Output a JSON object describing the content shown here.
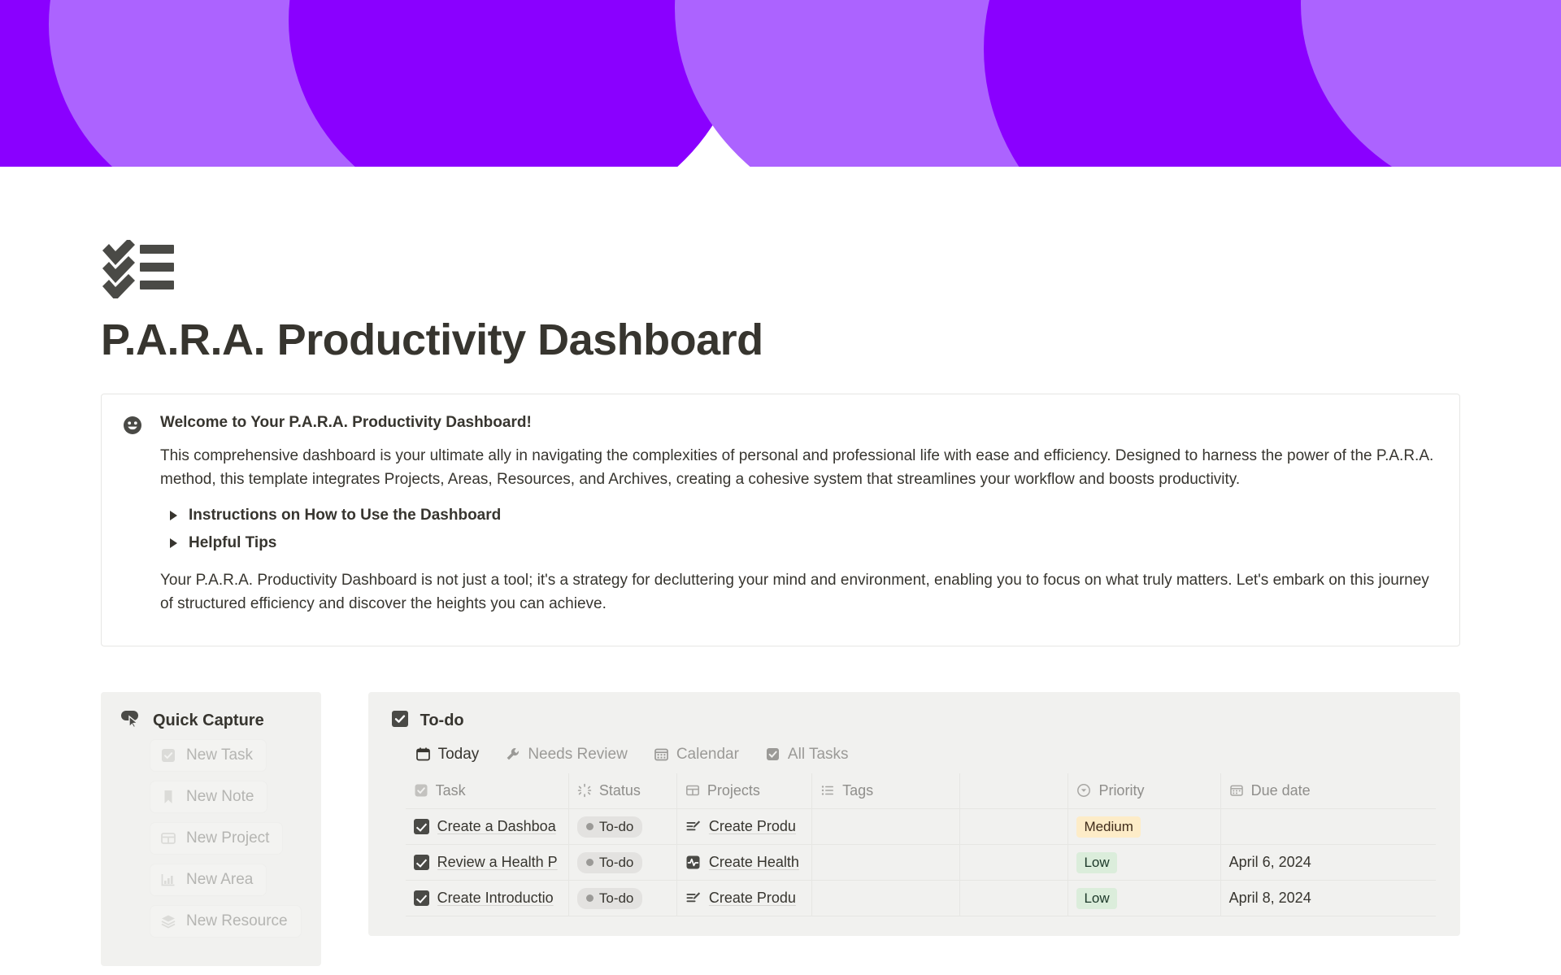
{
  "cover": {
    "colors": {
      "dark_purple": "#8A00FF",
      "light_purple": "#AC63FF"
    }
  },
  "page": {
    "icon": "checklist-icon",
    "title": "P.A.R.A. Productivity Dashboard"
  },
  "callout": {
    "emoji": "smiley-face-icon",
    "title": "Welcome to Your P.A.R.A. Productivity Dashboard!",
    "paragraph_1": "This comprehensive dashboard is your ultimate ally in navigating the complexities of personal and professional life with ease and efficiency. Designed to harness the power of the P.A.R.A. method, this template integrates Projects, Areas, Resources, and Archives, creating a cohesive system that streamlines your workflow and boosts productivity.",
    "toggles": [
      {
        "label": "Instructions on How to Use the Dashboard"
      },
      {
        "label": "Helpful Tips"
      }
    ],
    "paragraph_2": "Your P.A.R.A. Productivity Dashboard is not just a tool; it's a strategy for decluttering your mind and environment, enabling you to focus on what truly matters. Let's embark on this journey of structured efficiency and discover the heights you can achieve."
  },
  "quick_capture": {
    "icon": "cursor-click-icon",
    "title": "Quick Capture",
    "buttons": [
      {
        "label": "New Task",
        "icon": "checkbox-icon"
      },
      {
        "label": "New Note",
        "icon": "bookmark-icon"
      },
      {
        "label": "New Project",
        "icon": "table-icon"
      },
      {
        "label": "New Area",
        "icon": "bar-chart-icon"
      },
      {
        "label": "New Resource",
        "icon": "layers-icon"
      }
    ]
  },
  "todo": {
    "icon": "checkbox-icon",
    "title": "To-do",
    "tabs": [
      {
        "label": "Today",
        "icon": "calendar-day-icon",
        "active": true
      },
      {
        "label": "Needs Review",
        "icon": "wrench-icon",
        "active": false
      },
      {
        "label": "Calendar",
        "icon": "calendar-icon",
        "active": false
      },
      {
        "label": "All Tasks",
        "icon": "checkbox-icon",
        "active": false
      }
    ],
    "columns": [
      {
        "label": "Task",
        "icon": "checkbox-icon"
      },
      {
        "label": "Status",
        "icon": "status-spinner-icon"
      },
      {
        "label": "Projects",
        "icon": "table-icon"
      },
      {
        "label": "Tags",
        "icon": "multi-select-icon"
      },
      {
        "label": "Priority",
        "icon": "select-circle-icon"
      },
      {
        "label": "Due date",
        "icon": "calendar-icon"
      }
    ],
    "rows": [
      {
        "task": "Create a Dashboa",
        "status": "To-do",
        "project": "Create Produ",
        "project_icon": "notes-edit-icon",
        "tags": "",
        "priority": "Medium",
        "priority_color": "medium",
        "due_date": ""
      },
      {
        "task": "Review a Health P",
        "status": "To-do",
        "project": "Create Health",
        "project_icon": "activity-pulse-icon",
        "tags": "",
        "priority": "Low",
        "priority_color": "low",
        "due_date": "April 6, 2024"
      },
      {
        "task": "Create Introductio",
        "status": "To-do",
        "project": "Create Produ",
        "project_icon": "notes-edit-icon",
        "tags": "",
        "priority": "Low",
        "priority_color": "low",
        "due_date": "April 8, 2024"
      }
    ]
  }
}
